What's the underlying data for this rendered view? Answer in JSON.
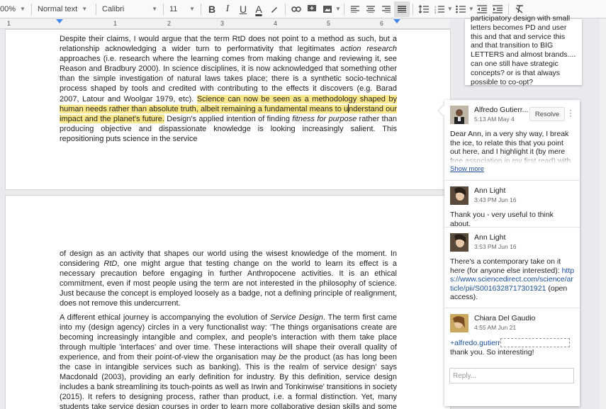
{
  "toolbar": {
    "zoom": "00%",
    "style": "Normal text",
    "font": "Calibri",
    "size": "11",
    "bold": "B",
    "italic": "I",
    "underline": "U",
    "textcolor": "A"
  },
  "ruler": {
    "ticks": [
      "1",
      "1",
      "2",
      "3",
      "4",
      "5",
      "6"
    ]
  },
  "page1": {
    "para_pre": "Despite their claims, I would argue that the term RtD does not point to a method as such, but a relationship acknowledging a wider turn to performativity that legitimates ",
    "para_italic": "action research",
    "para_mid": " approaches (i.e. research where the learning comes from making change and reviewing it, see Reason and Bradbury 2000). In science disciplines, it is now acknowledged that something other than the simple investigation of natural laws takes place; there is a synthetic socio-technical process shaped by tools and credited with contributing to the effects it discovers (e.g. Barad 2007, Latour and Woolgar 1979, etc). ",
    "highlight_a": "Science can now be seen as a methodology shaped by human needs rather than absolute truth, albeit remaining a fundamental means to u",
    "highlight_b": "nderstand our impact and the planet's future.",
    "tail_pre": " Design's applied intention of finding ",
    "tail_italic": "fitness for purpose",
    "tail_post": " rather than producing objective and dispassionate knowledge is looking increasingly salient. This repositioning puts science in the service"
  },
  "page2": {
    "p1_pre": "of design as an activity that shapes our world using the wisest knowledge of the moment. In considering ",
    "p1_italic": "RtD",
    "p1_post": ", one might argue that testing change on the world to learn its effect is a necessary precaution before engaging in further Anthropocene activities. It is an ethical commitment, even if most people using the term are not interested in the philosophy of science. Just because the concept is employed loosely as a badge, not a defining principle of realignment, does not remove this undercurrent.",
    "p2_pre": "A different ethical journey is accompanying the evolution of ",
    "p2_italic": "Service Design",
    "p2_mid": ". The term first came into my (design agency) circles in a very functionalist way: 'The things organisations create are becoming increasingly intangible and complex, and people's interaction with them take place through multiple 'interfaces' and over time. These interactions will shape their overall quality of experience, and from their point-of-view the organisation may ",
    "p2_italic2": "be",
    "p2_post": " the product (as has long been the case in intangible services such as banking). This is the realm of service design' says Macdonald (2003), providing an early definition for industry. By this definition, service design includes a bank streamlining its touch-points as well as Irwin and Tonkinwise' transitions in society (2015). It refers to designing process, rather than product, i.e. a formal distinction. Yet, many students take service design courses in order to learn more collaborative design skills and some design researchers understand it only in"
  },
  "comments": {
    "previous_text": "participatory design with small letters becomes PD and user this and that and service this and that transition to BIG LETTERS and almost brands.... can one still have strategic concepts? or is that always possible to co-opt?",
    "resolve_label": "Resolve",
    "show_more": "Show more",
    "reply_placeholder": "Reply...",
    "items": [
      {
        "name": "Alfredo Gutierr...",
        "time": "5:13 AM May 4",
        "text": "Dear Ann, in a very shy way, I break the ice, to relate this that you point out here, and I highlight it (by mere free association in my first read) with the"
      },
      {
        "name": "Ann Light",
        "time": "3:43 PM Jun 16",
        "text": "Thank you - very useful to think about."
      },
      {
        "name": "Ann Light",
        "time": "3:53 PM Jun 16",
        "text": "There's a contemporary take on it here (for anyone else interested): ",
        "link": "https://www.sciencedirect.com/science/article/pii/S0016328717301921",
        "text_after": " (open access)."
      },
      {
        "name": "Chiara Del Gaudio",
        "time": "4:55 AM Jun 21",
        "mention": "+alfredo.gutierr",
        "text": "thank you. So interesting!"
      }
    ]
  },
  "colors": {
    "highlight": "#fce98e",
    "link": "#1a4f9c",
    "ruler_marker": "#4285f4"
  }
}
